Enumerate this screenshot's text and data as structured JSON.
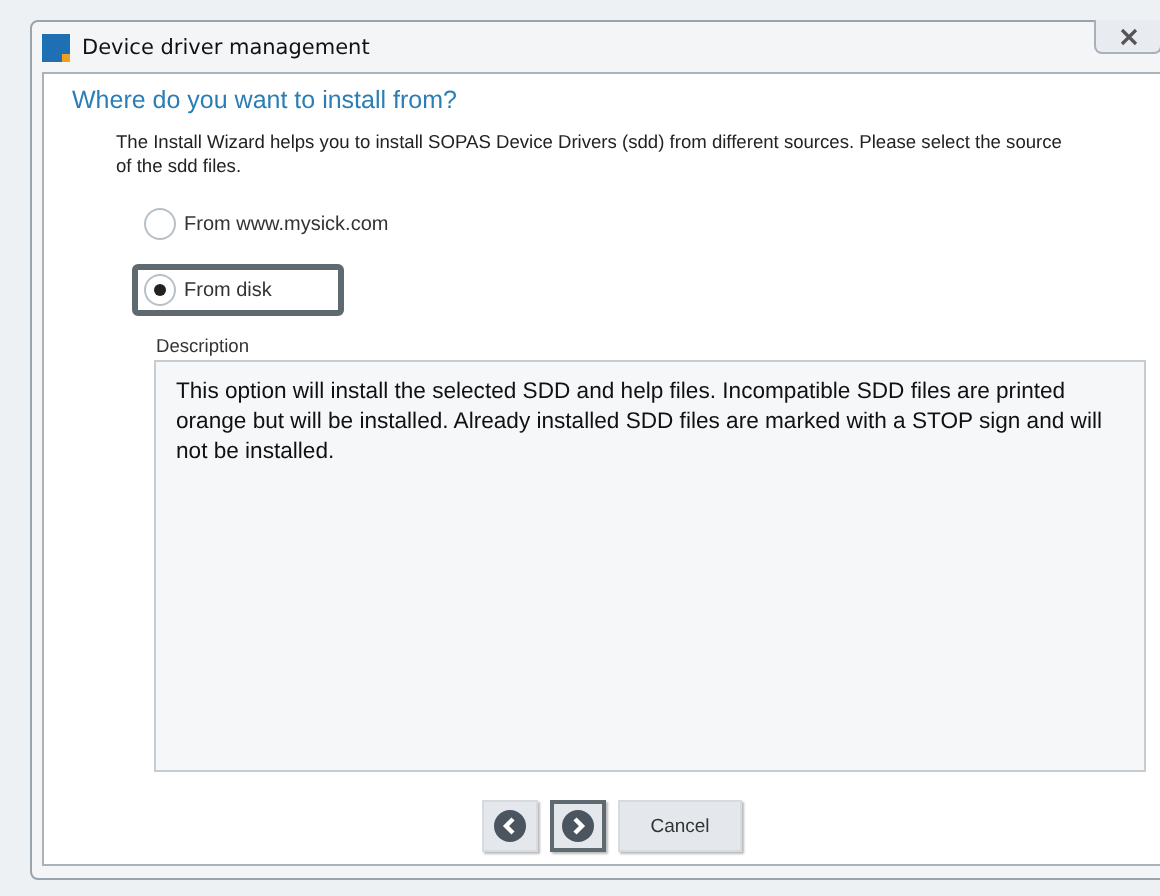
{
  "window": {
    "title": "Device driver management"
  },
  "heading": "Where do you want to install from?",
  "intro": "The Install Wizard helps you to install SOPAS Device Drivers (sdd) from different sources. Please select the source of the sdd files.",
  "options": [
    {
      "label": "From www.mysick.com",
      "selected": false
    },
    {
      "label": "From disk",
      "selected": true
    }
  ],
  "description": {
    "label": "Description",
    "text": "This option will install the selected SDD and help files. Incompatible SDD files are printed orange but will be installed. Already installed SDD files are marked with a STOP sign and will not be installed."
  },
  "buttons": [
    {
      "kind": "back",
      "focused": false
    },
    {
      "kind": "next",
      "focused": true
    },
    {
      "kind": "text",
      "label": "Cancel",
      "focused": false
    }
  ]
}
